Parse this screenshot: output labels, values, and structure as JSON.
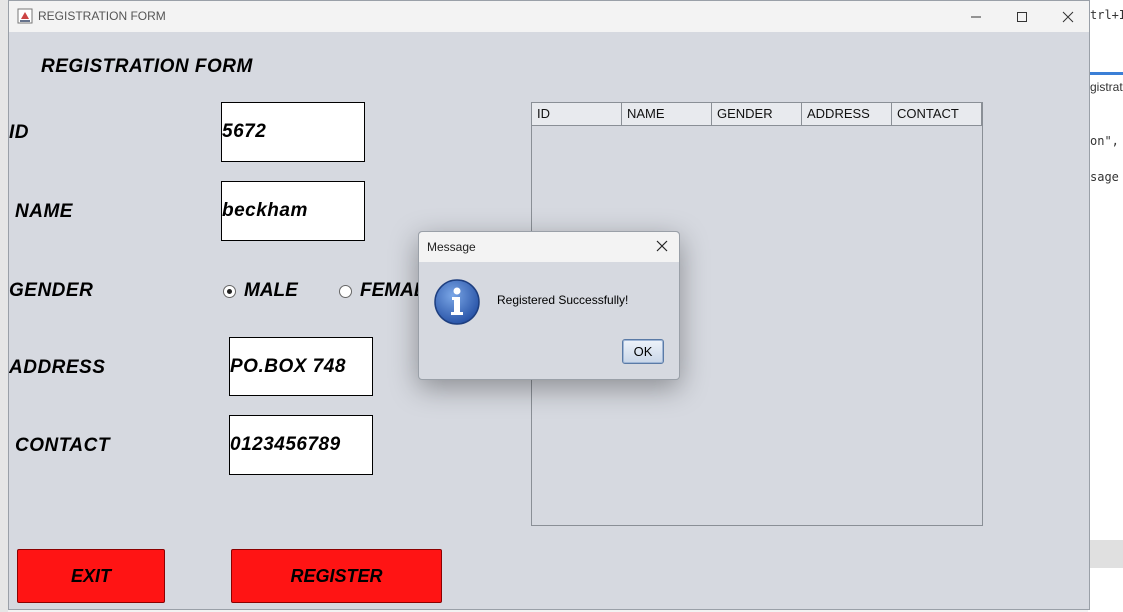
{
  "background": {
    "ide_text_1": "trl+I)",
    "ide_text_2": "gistrati",
    "ide_text_3": "on\",",
    "ide_text_4": "sage"
  },
  "window": {
    "title": "REGISTRATION FORM"
  },
  "form": {
    "heading": "REGISTRATION FORM",
    "id_label": "ID",
    "id_value": "5672",
    "name_label": "NAME",
    "name_value": "beckham",
    "gender_label": "GENDER",
    "gender_options": [
      {
        "label": "MALE",
        "selected": true
      },
      {
        "label": "FEMAL",
        "selected": false
      }
    ],
    "address_label": "ADDRESS",
    "address_value": "PO.BOX 748",
    "contact_label": "CONTACT",
    "contact_value": "0123456789",
    "exit_label": "EXIT",
    "register_label": "REGISTER"
  },
  "table": {
    "columns": [
      "ID",
      "NAME",
      "GENDER",
      "ADDRESS",
      "CONTACT"
    ]
  },
  "dialog": {
    "title": "Message",
    "message": "Registered Successfully!",
    "ok_label": "OK",
    "icon": "info-icon"
  },
  "colors": {
    "window_bg": "#d6d9e0",
    "button_red": "#ff1414",
    "info_blue": "#2f62b5"
  }
}
